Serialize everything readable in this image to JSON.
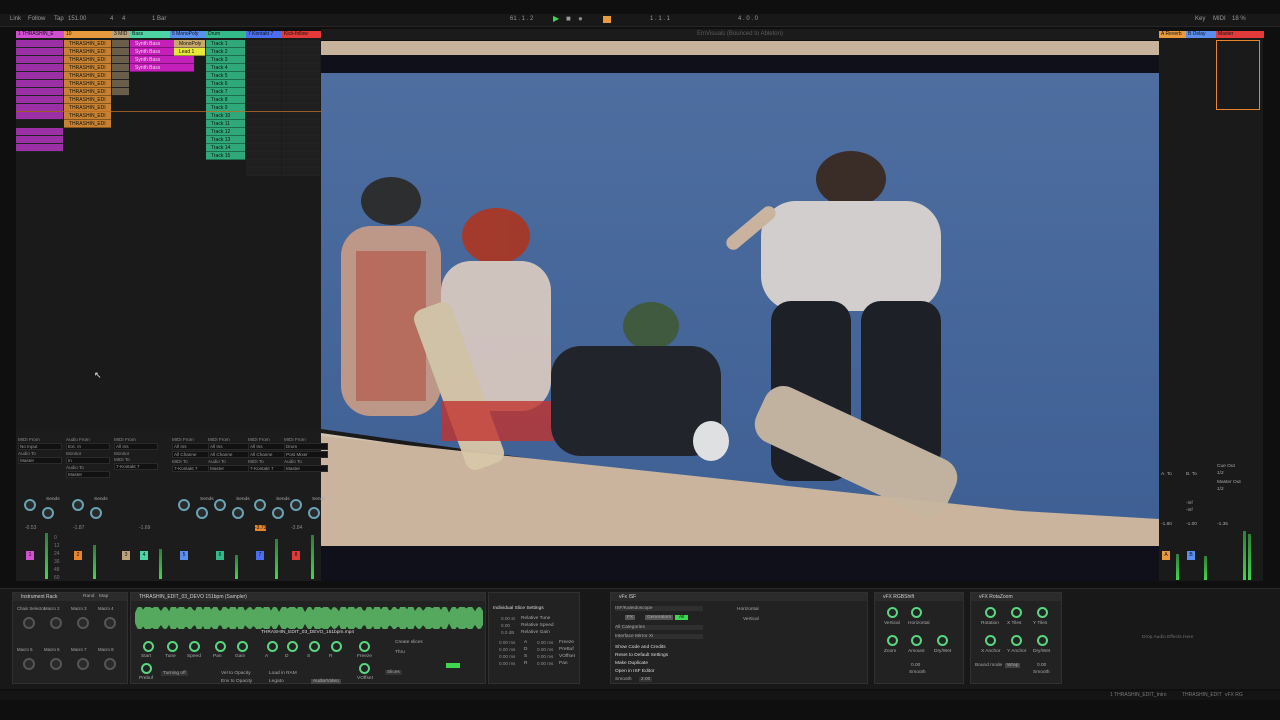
{
  "transport": {
    "link": "Link",
    "follow": "Follow",
    "tap": "Tap",
    "tempo": "151.00",
    "time_sig_num": "4",
    "time_sig_den": "4",
    "quantize": "1 Bar",
    "position": "61 . 1 . 2",
    "loop_start": "1 . 1 . 1",
    "loop_len": "4 . 0 . 0",
    "key": "Key",
    "midi": "MIDI",
    "cpu": "18 %"
  },
  "monitor": {
    "title": "EmVisuals (Bounced to Ableton)"
  },
  "tracks": [
    {
      "name": "1 THRASHIN_E",
      "color": "#d14fd1"
    },
    {
      "name": "10",
      "color": "#e89a3d"
    },
    {
      "name": "3 MID",
      "color": "#b9a27c"
    },
    {
      "name": "Bass",
      "color": "#4ed3a5"
    },
    {
      "name": "5 MonoPoly",
      "color": "#5a8ff0"
    },
    {
      "name": "Drum",
      "color": "#33b98a"
    },
    {
      "name": "7 Kontakt 7",
      "color": "#4b6ef0"
    },
    {
      "name": "Kick-follow",
      "color": "#e23a3a"
    }
  ],
  "clips": {
    "bass_clips": [
      "Synth Bass",
      "Synth Bass",
      "Synth Bass",
      "Synth Bass"
    ],
    "mono_clips": [
      "MonoPoly",
      "Lead 1"
    ],
    "track2_clips": [
      "THRASHIN_EDI",
      "THRASHIN_EDI",
      "THRASHIN_EDI",
      "THRASHIN_EDI",
      "THRASHIN_EDI",
      "THRASHIN_EDI",
      "THRASHIN_EDI",
      "THRASHIN_EDI",
      "THRASHIN_EDI",
      "THRASHIN_EDI",
      "THRASHIN_EDI"
    ],
    "drum_clips": [
      "Track 1",
      "Track 2",
      "Track 3",
      "Track 4",
      "Track 5",
      "Track 6",
      "Track 7",
      "Track 8",
      "Track 9",
      "Track 10",
      "Track 11",
      "Track 12",
      "Track 13",
      "Track 14",
      "Track 15"
    ]
  },
  "io": {
    "midi_from": "MIDI From",
    "audio_from": "Audio From",
    "no_input": "No Input",
    "ext_in": "Ext. In",
    "all_ins": "All Ins",
    "monitor": "Monitor",
    "in": "In",
    "auto": "Auto",
    "off": "Off",
    "audio_to": "Audio To",
    "midi_to": "MIDI To",
    "master": "Master",
    "kontakt": "7-Kontakt 7",
    "all_channels": "All Channe",
    "post_mixer": "Post Mixer",
    "drum": "Drum",
    "sends": "Sends"
  },
  "mixer": {
    "volumes": [
      "-0.53",
      "-1.87",
      "",
      "-1.69",
      "",
      "",
      "-3.73",
      "-3.84"
    ],
    "track_numbers": [
      "1",
      "2",
      "3",
      "4",
      "5",
      "6",
      "7",
      "8"
    ],
    "scale": [
      "0",
      "12",
      "24",
      "36",
      "48",
      "60"
    ]
  },
  "return_panel": {
    "reverb": "A Reverb",
    "delay": "B Delay",
    "master": "Master",
    "cue_out": "Cue Out",
    "cue_val": "1/2",
    "master_out": "Master Out",
    "master_out_val": "1/2",
    "a_to": "A. To",
    "b_to": "B. To",
    "inf": "-inf",
    "vol_a": "-1.80",
    "vol_b": "-1.00",
    "vol_m": "-1.35"
  },
  "devices": {
    "rack_title": "Instrument Rack",
    "rand": "Rand",
    "map": "Map",
    "macros": [
      "Chain Selector",
      "Macro 2",
      "Macro 3",
      "Macro 4",
      "Macro 5",
      "Macro 6",
      "Macro 7",
      "Macro 8"
    ],
    "sampler_title": "THRASHIN_EDIT_03_DEVO 151bpm (Sampler)",
    "sample_file": "THRASHIN_EDIT_03_DEVO_151bpm.mp4",
    "sampler_knobs": [
      "Start",
      "Tune",
      "Speed",
      "Pan",
      "Gain",
      "A",
      "D",
      "S",
      "R",
      "Freeze",
      "Prebuf",
      "VOffset"
    ],
    "turning_off": "Turning off",
    "vel_opacity": "Vel to Opacity",
    "env_opacity": "Env to Opacity",
    "load_ram": "Load in RAM",
    "legato": "Legato",
    "audio_video": "Audio/Video",
    "create_slices": "Create slices",
    "thru": "Thru",
    "slices": "Slices",
    "individual_slice": "Individual Slice Settings",
    "relative_tune": "Relative Tune",
    "relative_speed": "Relative Speed",
    "relative_gain": "Relative Gain",
    "slice_vals": [
      "0.00 st",
      "0.00",
      "0.0 dB"
    ],
    "slice_right": [
      "Freeze",
      "PreBuf",
      "VOffset",
      "Pan"
    ],
    "adsr_labels": [
      "A",
      "D",
      "S",
      "R"
    ],
    "adsr_vals": [
      "0.00 ms",
      "0.00 ms",
      "0.00 ms",
      "0.00 ms"
    ],
    "isf_title": "vFx ISF",
    "isf_dropdown": "ISF/Kaleidoscope",
    "isf_tab_fx": "FX",
    "isf_tab_gen": "Generators",
    "isf_tab_all": "All",
    "isf_categories": "All Categories",
    "isf_interface": "Interface Mirror Xi",
    "isf_menu": [
      "Show Code and Credits",
      "Reset to Default Settings",
      "Make Duplicate",
      "Open in ISF Editor"
    ],
    "isf_smooth": "Smooth",
    "isf_smooth_val": "2.00",
    "isf_horizontal": "Horizontal",
    "isf_vertical": "Vertical",
    "rgb_title": "vFX RGBShift",
    "rgb_knobs": [
      "Vertical",
      "Horizontal",
      "Zoom",
      "Amount",
      "Dry/Wet"
    ],
    "rgb_smooth": "Smooth",
    "rgb_val": "0.00",
    "rot_title": "vFX RotaZoom",
    "rot_knobs": [
      "Rotation",
      "X Tiles",
      "Y Tiles",
      "X Anchor",
      "Y Anchor",
      "Dry/Wet"
    ],
    "bound_mode": "Bound mode",
    "wrap": "Wrap",
    "rot_smooth": "Smooth",
    "rot_val": "0.00",
    "drop_text": "Drop Audio Effects Here"
  },
  "status": {
    "text": "1 THRASHIN_EDIT_Intro",
    "track": "THRASHIN_EDIT",
    "device": "vFX RG"
  }
}
